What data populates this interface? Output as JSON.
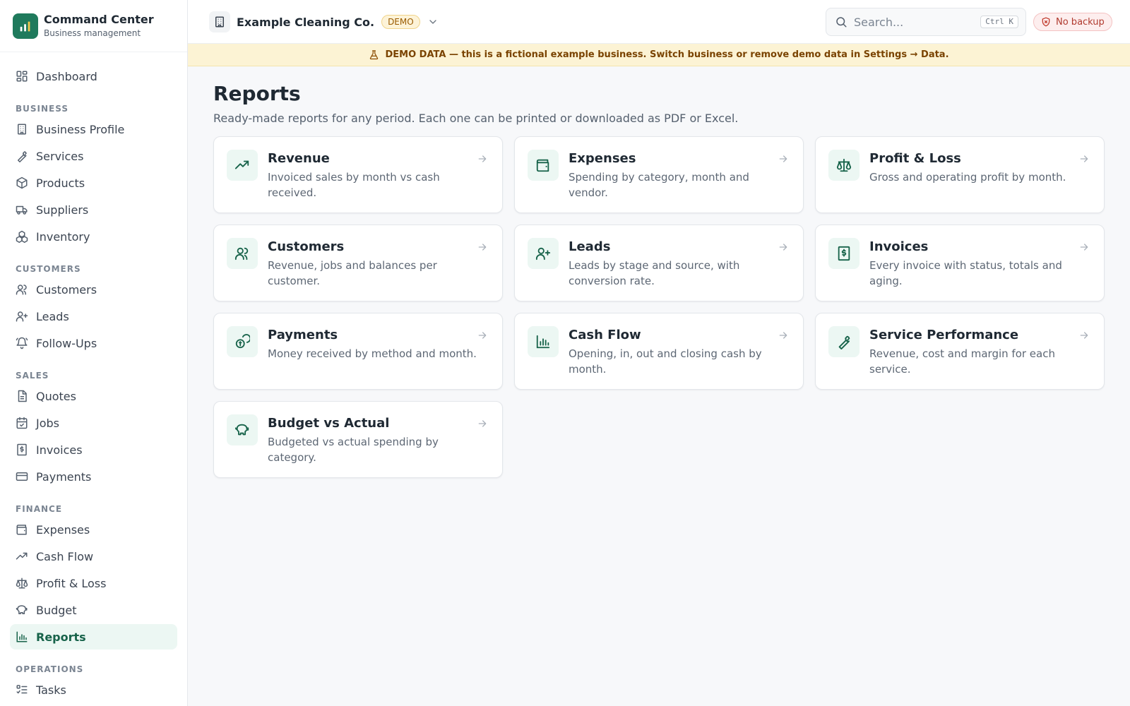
{
  "app": {
    "title": "Command Center",
    "subtitle": "Business management"
  },
  "sidebar": {
    "dashboard": {
      "label": "Dashboard",
      "icon": "dashboard-icon"
    },
    "sections": [
      {
        "label": "BUSINESS",
        "items": [
          {
            "label": "Business Profile",
            "icon": "building-icon"
          },
          {
            "label": "Services",
            "icon": "wrench-icon"
          },
          {
            "label": "Products",
            "icon": "box-icon"
          },
          {
            "label": "Suppliers",
            "icon": "truck-icon"
          },
          {
            "label": "Inventory",
            "icon": "boxes-icon"
          }
        ]
      },
      {
        "label": "CUSTOMERS",
        "items": [
          {
            "label": "Customers",
            "icon": "users-icon"
          },
          {
            "label": "Leads",
            "icon": "user-plus-icon"
          },
          {
            "label": "Follow-Ups",
            "icon": "bell-icon"
          }
        ]
      },
      {
        "label": "SALES",
        "items": [
          {
            "label": "Quotes",
            "icon": "document-icon"
          },
          {
            "label": "Jobs",
            "icon": "calendar-check-icon"
          },
          {
            "label": "Invoices",
            "icon": "invoice-icon"
          },
          {
            "label": "Payments",
            "icon": "credit-card-icon"
          }
        ]
      },
      {
        "label": "FINANCE",
        "items": [
          {
            "label": "Expenses",
            "icon": "wallet-icon"
          },
          {
            "label": "Cash Flow",
            "icon": "trending-up-icon"
          },
          {
            "label": "Profit & Loss",
            "icon": "scale-icon"
          },
          {
            "label": "Budget",
            "icon": "piggy-bank-icon"
          },
          {
            "label": "Reports",
            "icon": "bar-chart-icon",
            "active": true
          }
        ]
      },
      {
        "label": "OPERATIONS",
        "items": [
          {
            "label": "Tasks",
            "icon": "list-todo-icon"
          }
        ]
      }
    ]
  },
  "topbar": {
    "business_name": "Example Cleaning Co.",
    "demo_badge": "DEMO",
    "search_placeholder": "Search...",
    "search_shortcut": "Ctrl K",
    "backup_label": "No backup"
  },
  "banner": {
    "text": "DEMO DATA — this is a fictional example business. Switch business or remove demo data in Settings → Data."
  },
  "page": {
    "title": "Reports",
    "subtitle": "Ready-made reports for any period. Each one can be printed or downloaded as PDF or Excel."
  },
  "reports": [
    {
      "key": "revenue",
      "title": "Revenue",
      "description": "Invoiced sales by month vs cash received.",
      "icon": "trending-up-icon"
    },
    {
      "key": "expenses",
      "title": "Expenses",
      "description": "Spending by category, month and vendor.",
      "icon": "wallet-icon"
    },
    {
      "key": "profit-loss",
      "title": "Profit & Loss",
      "description": "Gross and operating profit by month.",
      "icon": "scale-icon"
    },
    {
      "key": "customers",
      "title": "Customers",
      "description": "Revenue, jobs and balances per customer.",
      "icon": "users-icon"
    },
    {
      "key": "leads",
      "title": "Leads",
      "description": "Leads by stage and source, with conversion rate.",
      "icon": "user-plus-icon"
    },
    {
      "key": "invoices",
      "title": "Invoices",
      "description": "Every invoice with status, totals and aging.",
      "icon": "invoice-icon"
    },
    {
      "key": "payments",
      "title": "Payments",
      "description": "Money received by method and month.",
      "icon": "coins-icon"
    },
    {
      "key": "cash-flow",
      "title": "Cash Flow",
      "description": "Opening, in, out and closing cash by month.",
      "icon": "bar-chart-icon"
    },
    {
      "key": "service-performance",
      "title": "Service Performance",
      "description": "Revenue, cost and margin for each service.",
      "icon": "wrench-icon"
    },
    {
      "key": "budget-vs-actual",
      "title": "Budget vs Actual",
      "description": "Budgeted vs actual spending by category.",
      "icon": "piggy-bank-icon"
    }
  ],
  "colors": {
    "accent": "#1f7a5c",
    "accent_soft": "#ecf7f3",
    "demo_banner": "#fcf3d4",
    "danger": "#c0392b"
  }
}
